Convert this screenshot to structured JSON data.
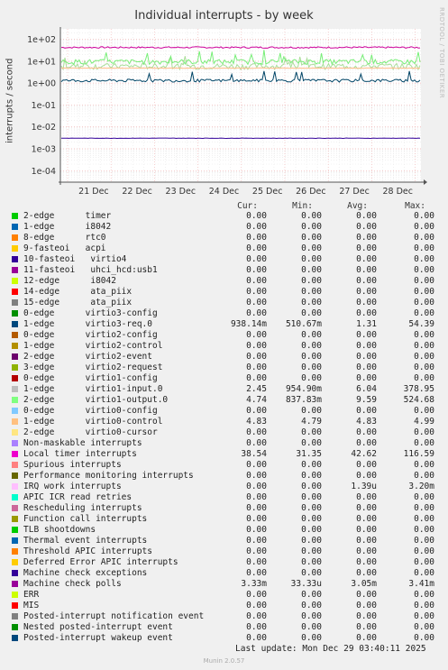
{
  "title": "Individual interrupts - by week",
  "watermark": "RRDTOOL / TOBI OETIKER",
  "footer": "Last update: Mon Dec 29 03:40:11 2025",
  "generator": "Munin 2.0.57",
  "chart_data": {
    "type": "line",
    "title": "Individual interrupts - by week",
    "ylabel": "interrupts / second",
    "yscale": "log",
    "ylim": [
      3e-05,
      300
    ],
    "y_ticks": [
      "1e+02",
      "1e+01",
      "1e+00",
      "1e-01",
      "1e-02",
      "1e-03",
      "1e-04"
    ],
    "y_tick_values": [
      100,
      10,
      1,
      0.1,
      0.01,
      0.001,
      0.0001
    ],
    "x_ticks": [
      "21 Dec",
      "22 Dec",
      "23 Dec",
      "24 Dec",
      "25 Dec",
      "26 Dec",
      "27 Dec",
      "28 Dec"
    ],
    "grid": true,
    "series": [
      {
        "name": "Local timer interrupts",
        "color": "#cc0099",
        "level": 42.62,
        "spread": 0.08
      },
      {
        "name": "virtio1-input.0",
        "color": "#aadd99",
        "level": 6.04,
        "spread": 0.3
      },
      {
        "name": "virtio1-output.0",
        "color": "#77ee77",
        "level": 9.59,
        "spread": 0.25
      },
      {
        "name": "virtio0-control",
        "color": "#ffbb88",
        "level": 4.83,
        "spread": 0.02
      },
      {
        "name": "virtio3-req.0",
        "color": "#004466",
        "level": 1.31,
        "spread": 0.15
      },
      {
        "name": "Machine check polls",
        "color": "#330099",
        "level": 0.00305,
        "spread": 0.02
      }
    ]
  },
  "legend_headers": {
    "cur": "Cur:",
    "min": "Min:",
    "avg": "Avg:",
    "max": "Max:"
  },
  "legend": [
    {
      "color": "#00cc00",
      "label": "2-edge      timer",
      "cur": "0.00",
      "min": "0.00",
      "avg": "0.00",
      "max": "0.00"
    },
    {
      "color": "#0066b3",
      "label": "1-edge      i8042",
      "cur": "0.00",
      "min": "0.00",
      "avg": "0.00",
      "max": "0.00"
    },
    {
      "color": "#ff8000",
      "label": "8-edge      rtc0",
      "cur": "0.00",
      "min": "0.00",
      "avg": "0.00",
      "max": "0.00"
    },
    {
      "color": "#ffcc00",
      "label": "9-fasteoi   acpi",
      "cur": "0.00",
      "min": "0.00",
      "avg": "0.00",
      "max": "0.00"
    },
    {
      "color": "#330099",
      "label": "10-fasteoi   virtio4",
      "cur": "0.00",
      "min": "0.00",
      "avg": "0.00",
      "max": "0.00"
    },
    {
      "color": "#990099",
      "label": "11-fasteoi   uhci_hcd:usb1",
      "cur": "0.00",
      "min": "0.00",
      "avg": "0.00",
      "max": "0.00"
    },
    {
      "color": "#ccff00",
      "label": "12-edge      i8042",
      "cur": "0.00",
      "min": "0.00",
      "avg": "0.00",
      "max": "0.00"
    },
    {
      "color": "#ff0000",
      "label": "14-edge      ata_piix",
      "cur": "0.00",
      "min": "0.00",
      "avg": "0.00",
      "max": "0.00"
    },
    {
      "color": "#808080",
      "label": "15-edge      ata_piix",
      "cur": "0.00",
      "min": "0.00",
      "avg": "0.00",
      "max": "0.00"
    },
    {
      "color": "#008f00",
      "label": "0-edge      virtio3-config",
      "cur": "0.00",
      "min": "0.00",
      "avg": "0.00",
      "max": "0.00"
    },
    {
      "color": "#00487d",
      "label": "1-edge      virtio3-req.0",
      "cur": "938.14m",
      "min": "510.67m",
      "avg": "1.31",
      "max": "54.39"
    },
    {
      "color": "#b35a00",
      "label": "0-edge      virtio2-config",
      "cur": "0.00",
      "min": "0.00",
      "avg": "0.00",
      "max": "0.00"
    },
    {
      "color": "#b38f00",
      "label": "1-edge      virtio2-control",
      "cur": "0.00",
      "min": "0.00",
      "avg": "0.00",
      "max": "0.00"
    },
    {
      "color": "#6b006b",
      "label": "2-edge      virtio2-event",
      "cur": "0.00",
      "min": "0.00",
      "avg": "0.00",
      "max": "0.00"
    },
    {
      "color": "#8fb300",
      "label": "3-edge      virtio2-request",
      "cur": "0.00",
      "min": "0.00",
      "avg": "0.00",
      "max": "0.00"
    },
    {
      "color": "#b30000",
      "label": "0-edge      virtio1-config",
      "cur": "0.00",
      "min": "0.00",
      "avg": "0.00",
      "max": "0.00"
    },
    {
      "color": "#bebebe",
      "label": "1-edge      virtio1-input.0",
      "cur": "2.45",
      "min": "954.90m",
      "avg": "6.04",
      "max": "378.95"
    },
    {
      "color": "#80ff80",
      "label": "2-edge      virtio1-output.0",
      "cur": "4.74",
      "min": "837.83m",
      "avg": "9.59",
      "max": "524.68"
    },
    {
      "color": "#80c9ff",
      "label": "0-edge      virtio0-config",
      "cur": "0.00",
      "min": "0.00",
      "avg": "0.00",
      "max": "0.00"
    },
    {
      "color": "#ffc080",
      "label": "1-edge      virtio0-control",
      "cur": "4.83",
      "min": "4.79",
      "avg": "4.83",
      "max": "4.99"
    },
    {
      "color": "#ffe680",
      "label": "2-edge      virtio0-cursor",
      "cur": "0.00",
      "min": "0.00",
      "avg": "0.00",
      "max": "0.00"
    },
    {
      "color": "#aa80ff",
      "label": "Non-maskable interrupts",
      "cur": "0.00",
      "min": "0.00",
      "avg": "0.00",
      "max": "0.00"
    },
    {
      "color": "#ee00cc",
      "label": "Local timer interrupts",
      "cur": "38.54",
      "min": "31.35",
      "avg": "42.62",
      "max": "116.59"
    },
    {
      "color": "#ff8080",
      "label": "Spurious interrupts",
      "cur": "0.00",
      "min": "0.00",
      "avg": "0.00",
      "max": "0.00"
    },
    {
      "color": "#666600",
      "label": "Performance monitoring interrupts",
      "cur": "0.00",
      "min": "0.00",
      "avg": "0.00",
      "max": "0.00"
    },
    {
      "color": "#ffbfff",
      "label": "IRQ work interrupts",
      "cur": "0.00",
      "min": "0.00",
      "avg": "1.39u",
      "max": "3.20m"
    },
    {
      "color": "#00ffcc",
      "label": "APIC ICR read retries",
      "cur": "0.00",
      "min": "0.00",
      "avg": "0.00",
      "max": "0.00"
    },
    {
      "color": "#cc6699",
      "label": "Rescheduling interrupts",
      "cur": "0.00",
      "min": "0.00",
      "avg": "0.00",
      "max": "0.00"
    },
    {
      "color": "#999900",
      "label": "Function call interrupts",
      "cur": "0.00",
      "min": "0.00",
      "avg": "0.00",
      "max": "0.00"
    },
    {
      "color": "#00cc00",
      "label": "TLB shootdowns",
      "cur": "0.00",
      "min": "0.00",
      "avg": "0.00",
      "max": "0.00"
    },
    {
      "color": "#0066b3",
      "label": "Thermal event interrupts",
      "cur": "0.00",
      "min": "0.00",
      "avg": "0.00",
      "max": "0.00"
    },
    {
      "color": "#ff8000",
      "label": "Threshold APIC interrupts",
      "cur": "0.00",
      "min": "0.00",
      "avg": "0.00",
      "max": "0.00"
    },
    {
      "color": "#ffcc00",
      "label": "Deferred Error APIC interrupts",
      "cur": "0.00",
      "min": "0.00",
      "avg": "0.00",
      "max": "0.00"
    },
    {
      "color": "#330099",
      "label": "Machine check exceptions",
      "cur": "0.00",
      "min": "0.00",
      "avg": "0.00",
      "max": "0.00"
    },
    {
      "color": "#990099",
      "label": "Machine check polls",
      "cur": "3.33m",
      "min": "33.33u",
      "avg": "3.05m",
      "max": "3.41m"
    },
    {
      "color": "#ccff00",
      "label": "ERR",
      "cur": "0.00",
      "min": "0.00",
      "avg": "0.00",
      "max": "0.00"
    },
    {
      "color": "#ff0000",
      "label": "MIS",
      "cur": "0.00",
      "min": "0.00",
      "avg": "0.00",
      "max": "0.00"
    },
    {
      "color": "#808080",
      "label": "Posted-interrupt notification event",
      "cur": "0.00",
      "min": "0.00",
      "avg": "0.00",
      "max": "0.00"
    },
    {
      "color": "#008f00",
      "label": "Nested posted-interrupt event",
      "cur": "0.00",
      "min": "0.00",
      "avg": "0.00",
      "max": "0.00"
    },
    {
      "color": "#00487d",
      "label": "Posted-interrupt wakeup event",
      "cur": "0.00",
      "min": "0.00",
      "avg": "0.00",
      "max": "0.00"
    }
  ]
}
